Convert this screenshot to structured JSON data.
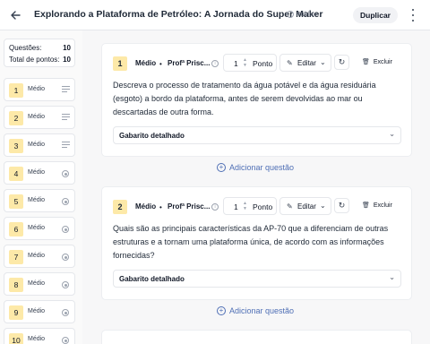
{
  "header": {
    "back_icon": "arrow-left-icon",
    "title": "Explorando a Plataforma de Petróleo: A Jornada do Super Maker",
    "visibility": "Público",
    "duplicate_label": "Duplicar",
    "more_icon": "kebab-icon"
  },
  "sidebar": {
    "summary": {
      "questions_label": "Questões:",
      "questions_value": "10",
      "points_label": "Total de pontos:",
      "points_value": "10"
    },
    "items": [
      {
        "num": "1",
        "level": "Médio",
        "icon": "lines-icon"
      },
      {
        "num": "2",
        "level": "Médio",
        "icon": "lines-icon"
      },
      {
        "num": "3",
        "level": "Médio",
        "icon": "lines-icon"
      },
      {
        "num": "4",
        "level": "Médio",
        "icon": "radio-icon"
      },
      {
        "num": "5",
        "level": "Médio",
        "icon": "radio-icon"
      },
      {
        "num": "6",
        "level": "Médio",
        "icon": "radio-icon"
      },
      {
        "num": "7",
        "level": "Médio",
        "icon": "radio-icon"
      },
      {
        "num": "8",
        "level": "Médio",
        "icon": "radio-icon"
      },
      {
        "num": "9",
        "level": "Médio",
        "icon": "radio-icon"
      },
      {
        "num": "10",
        "level": "Médio",
        "icon": "radio-icon"
      }
    ]
  },
  "questions": [
    {
      "num": "1",
      "level": "Médio",
      "author": "Profª Prisc...",
      "points": "1",
      "points_label": "Ponto",
      "edit_label": "Editar",
      "delete_label": "Excluir",
      "text": "Descreva o processo de tratamento da água potável e da água residuária (esgoto) a bordo da plataforma, antes de serem devolvidas ao mar ou descartadas de outra forma.",
      "answer_key": "Gabarito detalhado"
    },
    {
      "num": "2",
      "level": "Médio",
      "author": "Profª Prisc...",
      "points": "1",
      "points_label": "Ponto",
      "edit_label": "Editar",
      "delete_label": "Excluir",
      "text": "Quais são as principais características da AP-70 que a diferenciam de outras estruturas e a tornam uma plataforma única, de acordo com as informações fornecidas?",
      "answer_key": "Gabarito detalhado"
    }
  ],
  "add_question_label": "Adicionar questão",
  "colors": {
    "accent": "#4f6fb5",
    "number_badge": "#fde9a8"
  }
}
